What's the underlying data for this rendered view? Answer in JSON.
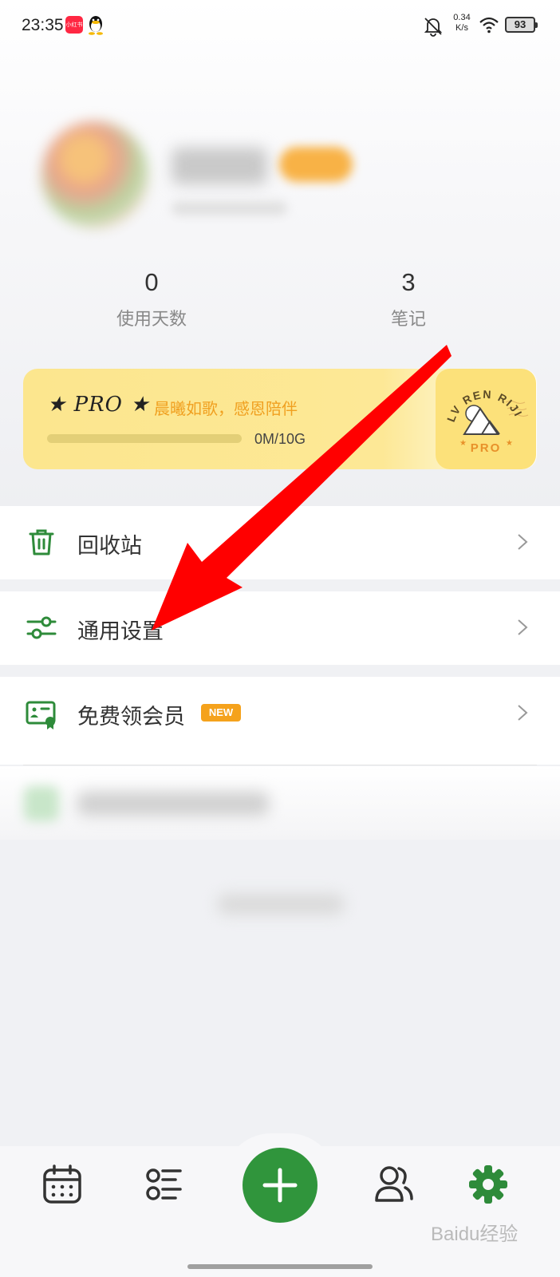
{
  "status_bar": {
    "time": "23:35",
    "app1_label": "小红书",
    "net_speed_value": "0.34",
    "net_speed_unit": "K/s",
    "battery": "93"
  },
  "stats": {
    "days_value": "0",
    "days_label": "使用天数",
    "notes_value": "3",
    "notes_label": "笔记"
  },
  "pro_card": {
    "title": "★ PRO ★",
    "slogan": "晨曦如歌，感恩陪伴",
    "storage": "0M/10G",
    "storage_used_fraction": 0.0,
    "stamp_lines": [
      "LV REN RIJI",
      "PRO"
    ]
  },
  "menu": {
    "trash_label": "回收站",
    "settings_label": "通用设置",
    "vip_label": "免费领会员",
    "new_badge": "NEW"
  },
  "watermark": "Baidu经验",
  "colors": {
    "accent_green": "#30953c",
    "pro_yellow": "#fce68e",
    "new_badge_orange": "#f5a21c",
    "arrow_red": "#ff0000"
  }
}
